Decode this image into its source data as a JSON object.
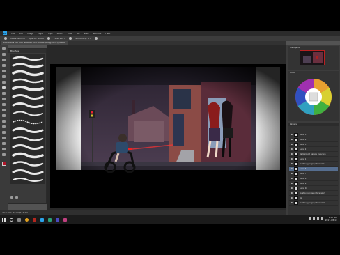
{
  "app": {
    "menu": [
      "File",
      "Edit",
      "Image",
      "Layer",
      "Type",
      "Select",
      "Filter",
      "3D",
      "View",
      "Window",
      "Help"
    ],
    "logo": "Ps"
  },
  "options": {
    "mode_label": "Mode: Normal",
    "opacity_label": "Opacity: 100%",
    "flow_label": "Flow: 100%",
    "smoothing_label": "Smoothing: 0%"
  },
  "document": {
    "tab_title": "LOCATION TATTOO GARAGE CUTSCENE.psd @ 50% (RGB/8)"
  },
  "brush_panel": {
    "title": "Brushes"
  },
  "panels": {
    "navigator_label": "Navigator",
    "color_label": "Color",
    "layers_label": "Layers"
  },
  "layers": [
    {
      "name": "Layer 5",
      "selected": false
    },
    {
      "name": "Layer 4",
      "selected": false
    },
    {
      "name": "Layer 3",
      "selected": false
    },
    {
      "name": "Layer 2",
      "selected": false
    },
    {
      "name": "Background_garage_cutscene",
      "selected": false
    },
    {
      "name": "Layer 1",
      "selected": false
    },
    {
      "name": "location_garage_cutscene01",
      "selected": false
    },
    {
      "name": "Layer 6",
      "selected": true
    },
    {
      "name": "Layer 7",
      "selected": false
    },
    {
      "name": "Layer 8",
      "selected": false
    },
    {
      "name": "Layer 9",
      "selected": false
    },
    {
      "name": "Layer 10",
      "selected": false
    },
    {
      "name": "location_garage_cutscene02",
      "selected": false
    },
    {
      "name": "Bg",
      "selected": false
    },
    {
      "name": "location_garage_cutscene03",
      "selected": false
    }
  ],
  "status": {
    "zoom": "50%",
    "doc": "Doc: 19.8M/111.5M"
  },
  "taskbar": {
    "time": "2:17 PM",
    "date": "2017-08-11"
  },
  "colors": {
    "accent": "#2ba3ea",
    "selected_layer": "#566e8f",
    "foreground": "#b2162a"
  }
}
